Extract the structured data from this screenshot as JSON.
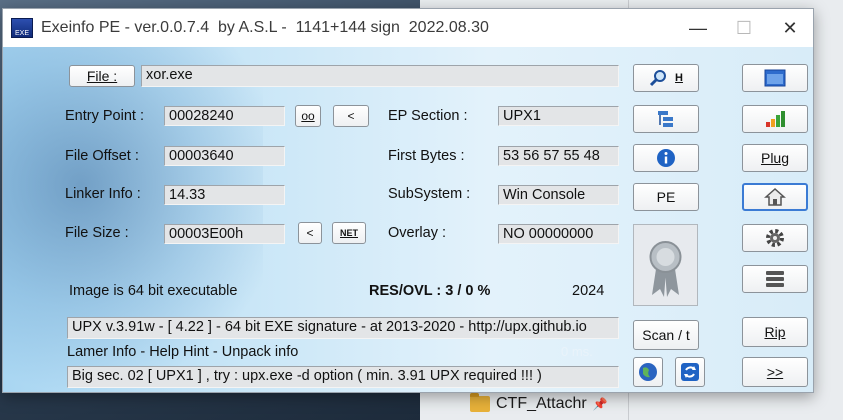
{
  "window": {
    "title": "Exeinfo PE - ver.0.0.7.4  by A.S.L -  1141+144 sign  2022.08.30",
    "icon_label": "EXE"
  },
  "file": {
    "button_label": "File :",
    "value": "xor.exe"
  },
  "fields": {
    "entry_point": {
      "label": "Entry Point :",
      "value": "00028240"
    },
    "file_offset": {
      "label": "File Offset :",
      "value": "00003640"
    },
    "linker_info": {
      "label": "Linker Info :",
      "value": "14.33"
    },
    "file_size": {
      "label": "File Size :",
      "value": "00003E00h"
    },
    "ep_section": {
      "label": "EP Section :",
      "value": "UPX1"
    },
    "first_bytes": {
      "label": "First Bytes :",
      "value": "53 56 57 55 48"
    },
    "subsystem": {
      "label": "SubSystem :",
      "value": "Win Console"
    },
    "overlay": {
      "label": "Overlay :",
      "value": "NO   00000000"
    }
  },
  "small_buttons": {
    "oo": "oo",
    "prev_ep": "<",
    "prev_size": "<",
    "net": "NET"
  },
  "status": {
    "image_bits": "Image is 64 bit executable",
    "res_ovl": "RES/OVL : 3 / 0 %",
    "year": "2024"
  },
  "detection": "UPX v.3.91w - [ 4.22 ] - 64 bit EXE signature  - at  2013-2020 - http://upx.github.io",
  "lamer_info": "Lamer Info - Help Hint - Unpack info",
  "timing": "0 ms.",
  "hint": "Big sec. 02 [ UPX1 ] , try : upx.exe -d option ( min. 3.91 UPX required !!! )",
  "buttons": {
    "search_h": "H",
    "pe": "PE",
    "scan": "Scan / t",
    "plug": "Plug",
    "rip": "Rip",
    "next": ">>"
  },
  "desktop": {
    "explorer_item": "CTF_Attachr"
  },
  "colors": {
    "accent_blue": "#3b7bd4",
    "client_bg": "#c9e6f7"
  }
}
